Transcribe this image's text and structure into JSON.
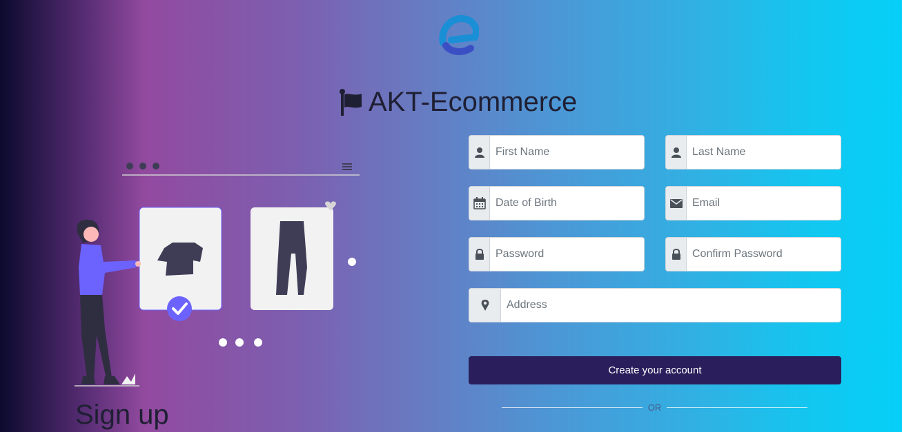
{
  "brand": {
    "name": "AKT-Ecommerce"
  },
  "signup": {
    "title": "Sign up"
  },
  "form": {
    "first_name": {
      "placeholder": "First Name"
    },
    "last_name": {
      "placeholder": "Last Name"
    },
    "dob": {
      "placeholder": "Date of Birth"
    },
    "email": {
      "placeholder": "Email"
    },
    "password": {
      "placeholder": "Password"
    },
    "confirm_password": {
      "placeholder": "Confirm Password"
    },
    "address": {
      "placeholder": "Address"
    },
    "submit_label": "Create your account",
    "or_label": "OR"
  },
  "colors": {
    "button": "#2a1f5c",
    "accent": "#6c63ff",
    "addon_bg": "#e9ecef"
  },
  "icons": {
    "first_name": "user-icon",
    "last_name": "user-icon",
    "dob": "calendar-icon",
    "email": "envelope-icon",
    "password": "lock-icon",
    "confirm_password": "lock-icon",
    "address": "map-marker-icon"
  }
}
